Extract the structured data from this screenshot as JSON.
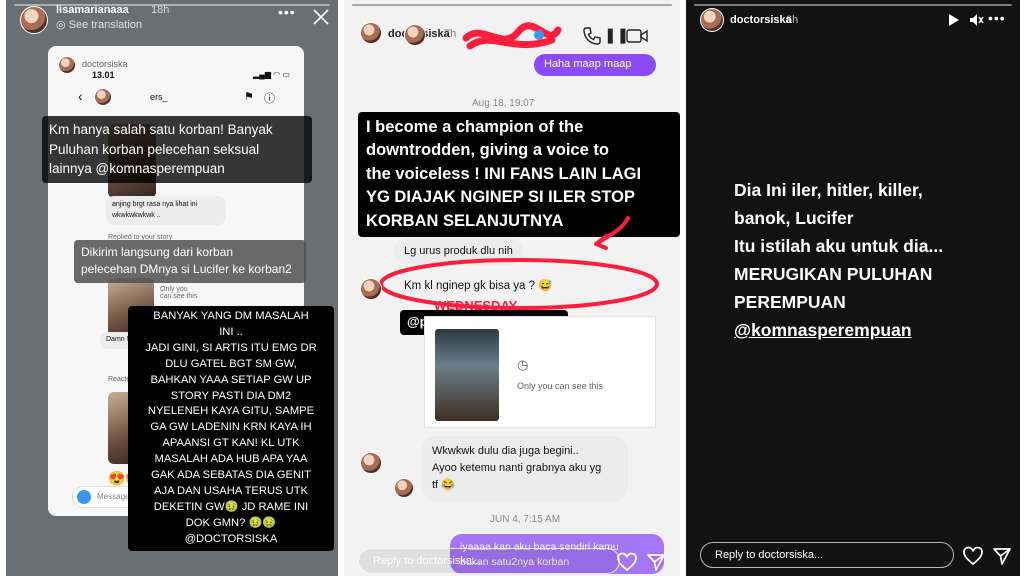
{
  "story1": {
    "username": "lisamarianaaa",
    "time": "18h",
    "see_translation": "See translation",
    "inner": {
      "username": "doctorsiska",
      "clock": "13.01",
      "chat_username": "ers_",
      "msg_small_1": "anjing brgt rasa nya lihat ini wkwkwkwkwk ..",
      "replied": "Replied to your story",
      "only_you": "Only you can see this",
      "damn": "Damn !!! Prfct",
      "reacted": "Reacted",
      "message_placeholder": "Message..."
    },
    "label_top": [
      "Km hanya salah satu korban! Banyak",
      "Puluhan korban pelecehan seksual",
      "lainnya @komnasperempuan"
    ],
    "label_mid": [
      "Dikirim langsung dari korban",
      "pelecehan DMnya si Lucifer ke korban2"
    ],
    "label_bottom": [
      "BANYAK YANG DM MASALAH",
      "INI ..",
      "JADI GINI, SI ARTIS ITU EMG DR",
      "DLU GATEL BGT SM GW,",
      "BAHKAN YAAA SETIAP GW UP",
      "STORY PASTI DIA DM2",
      "NYELENEH KAYA GITU, SAMPE",
      "GA GW LADENIN KRN KAYA IH",
      "APAANSI GT KAN! KL UTK",
      "MASALAH ADA HUB APA YAA",
      "GAK ADA SEBATAS DIA GENIT",
      "AJA DAN USAHA TERUS UTK",
      "DEKETIN GW🤢 JD RAME INI",
      "DOK GMN? 🤢🤢",
      "@DOCTORSISKA"
    ]
  },
  "story2": {
    "username": "doctorsiska",
    "time": "7h",
    "sent_bubble": "Haha maap maap",
    "date1": "Aug 18, 19:07",
    "label_black": [
      "I become a champion of the",
      "downtrodden, giving a voice to",
      "the voiceless ! INI FANS LAIN LAGI",
      "YG DIAJAK NGINEP SI ILER STOP",
      "KORBAN SELANJUTNYA"
    ],
    "msg_produk": "Lg urus produk dlu nih",
    "msg_nginep": "Km kl nginep gk bisa ya ? 😅",
    "behind_text": "WEDNESDAY",
    "mention": "@pitraromadoninasution",
    "only_you": "Only you can see this",
    "msg_wkwk": [
      "Wkwkwk dulu dia juga begini..",
      "Ayoo ketemu nanti grabnya aku yg",
      "tf 😂"
    ],
    "date2": "JUN 4, 7:15 AM",
    "sent_bottom": [
      "iyaaaa kan aku baca sendiri kamu",
      "bukan satu2nya korban"
    ],
    "reply_placeholder": "Reply to doctorsiska..."
  },
  "story3": {
    "username": "doctorsiska",
    "time": "6h",
    "lines": [
      "Dia Ini iler, hitler, killer,",
      "banok, Lucifer",
      "Itu istilah aku untuk dia...",
      "MERUGIKAN PULUHAN",
      "PEREMPUAN"
    ],
    "mention": "@komnasperempuan",
    "reply_placeholder": "Reply to doctorsiska..."
  },
  "icons": {
    "more": "ellipsis-icon",
    "close": "close-icon",
    "phone": "phone-icon",
    "video": "video-icon",
    "play": "play-icon",
    "mute": "mute-icon",
    "heart": "heart-icon",
    "send": "send-icon"
  },
  "colors": {
    "purple_bubble": "#8b4cf7",
    "red_scribble": "#ff1f3d",
    "story3_bg": "#121212"
  }
}
